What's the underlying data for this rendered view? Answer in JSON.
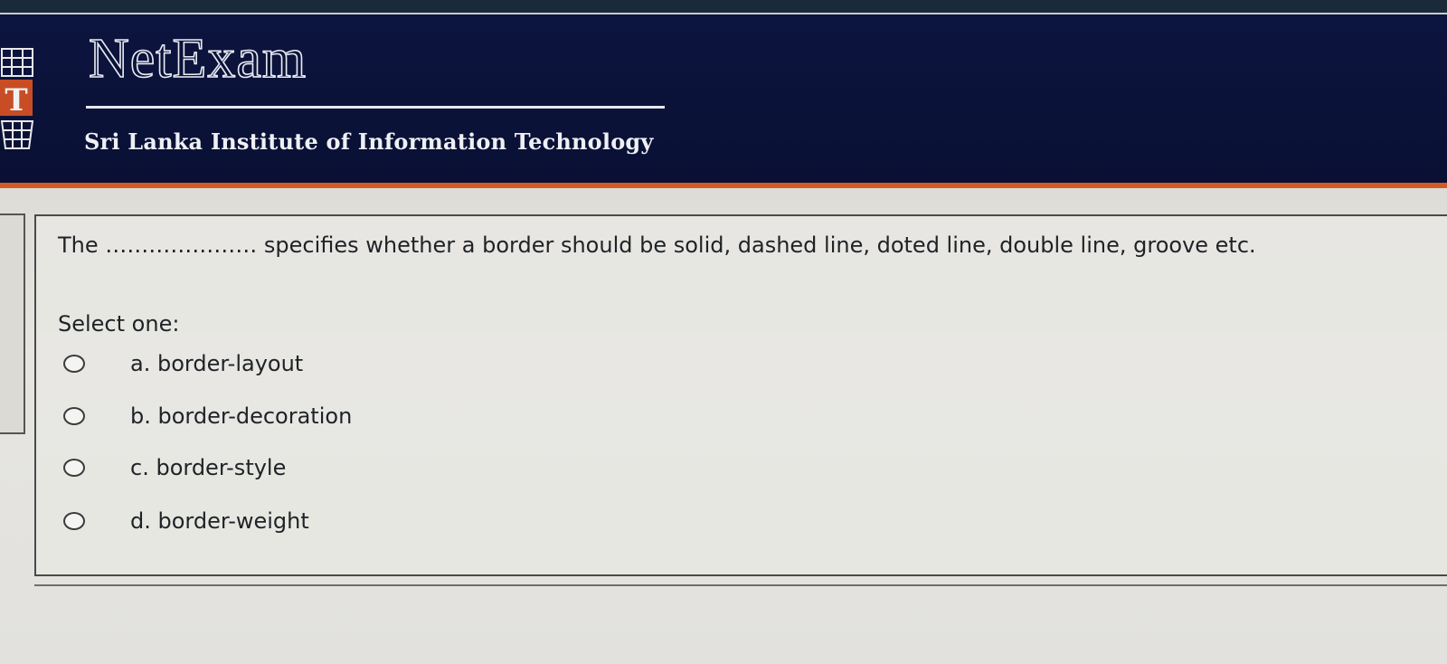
{
  "header": {
    "brand_title": "NetExam",
    "subtitle": "Sri Lanka Institute of Information Technology",
    "logo_icon": "sliit-logo-icon",
    "accent_color": "#d35a26",
    "background_color": "#0b1238"
  },
  "question": {
    "text": "The ………………… specifies whether a border should be solid, dashed line, doted line, double line, groove etc.",
    "prompt": "Select one:",
    "options": [
      {
        "label": "a. border-layout",
        "selected": false
      },
      {
        "label": "b. border-decoration",
        "selected": false
      },
      {
        "label": "c. border-style",
        "selected": false
      },
      {
        "label": "d. border-weight",
        "selected": false
      }
    ]
  }
}
